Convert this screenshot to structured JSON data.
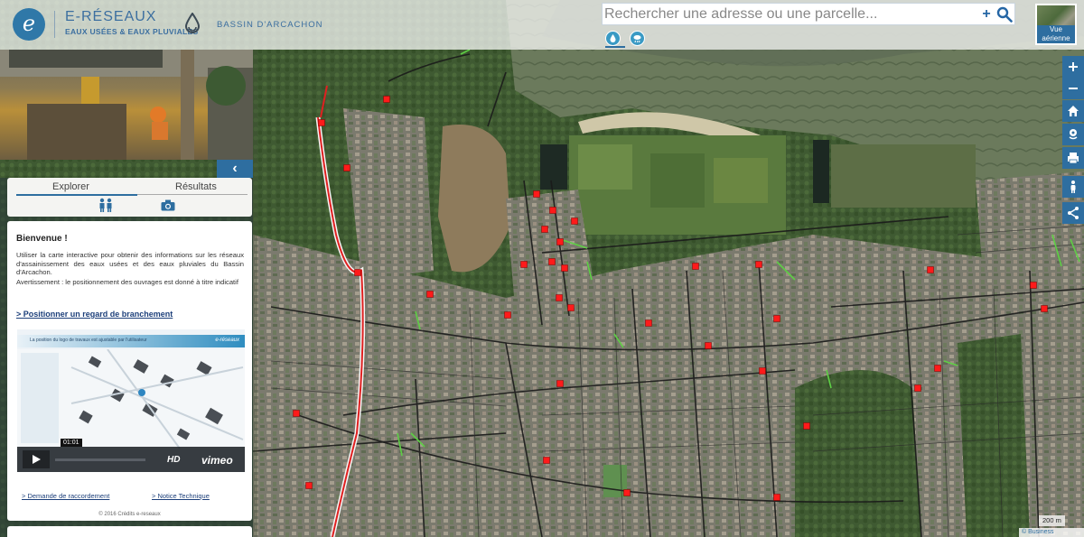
{
  "header": {
    "logo_letter": "e",
    "brand_title": "E-RÉSEAUX",
    "brand_subtitle": "EAUX USÉES & EAUX PLUVIALES",
    "partner": "BASSIN D'ARCACHON"
  },
  "search": {
    "placeholder": "Rechercher une adresse ou une parcelle...",
    "value": "",
    "add_label": "+"
  },
  "basemap_toggle": {
    "label": "Vue aérienne"
  },
  "right_toolbar": [
    "zoom-in",
    "zoom-out",
    "home",
    "locate",
    "print",
    "street-view",
    "share"
  ],
  "panel": {
    "collapse_label": "‹",
    "tabs": [
      {
        "label": "Explorer",
        "active": true
      },
      {
        "label": "Résultats",
        "active": false
      }
    ],
    "welcome_title": "Bienvenue !",
    "welcome_text": "Utiliser la carte interactive pour obtenir des informations sur les réseaux d'assainissement des eaux usées et des eaux pluviales du Bassin d'Arcachon.",
    "warning_text": "Avertissement : le positionnement des ouvrages est donné à titre indicatif",
    "primary_link": ">  Positionner un regard de branchement",
    "video": {
      "caption": "La position du logo de travaux est ajustable par l'utilisateur",
      "brand": "e-réseaux",
      "time": "01:01",
      "hd": "HD",
      "provider": "vimeo",
      "progress": 0.0
    },
    "link_raccordement": ">  Demande de raccordement",
    "link_notice": ">  Notice Technique",
    "credits": "© 2016 Crédits e-reseaux"
  },
  "map": {
    "scale_label": "200 m",
    "attribution": "© Business Geografic",
    "colors": {
      "network_red": "#e02020",
      "manhole": "#ff1a1a",
      "rainwater_green": "#5ecf45",
      "accent": "#2e6ea0"
    }
  }
}
